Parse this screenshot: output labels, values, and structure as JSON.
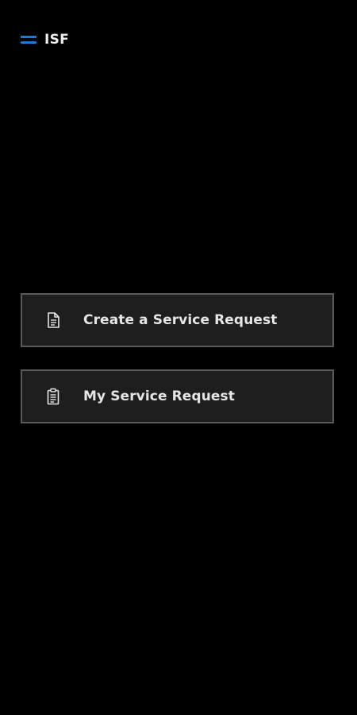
{
  "header": {
    "menu_icon": "hamburger-menu-icon",
    "title": "ISF"
  },
  "actions": [
    {
      "icon": "document-icon",
      "label": "Create a Service Request"
    },
    {
      "icon": "clipboard-list-icon",
      "label": "My Service Request"
    }
  ],
  "colors": {
    "background": "#000000",
    "accent": "#1e78d2",
    "button_bg": "#1e1e1e",
    "button_border": "#5a5a5a",
    "text": "#e6e6e6"
  }
}
